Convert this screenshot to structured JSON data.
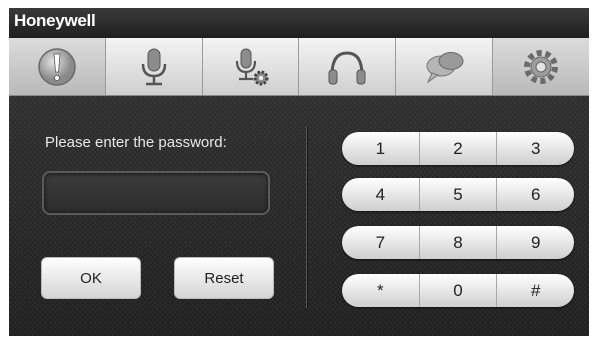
{
  "brand": "Honeywell",
  "toolbar": {
    "tabs": [
      {
        "icon": "alert-icon",
        "active": true
      },
      {
        "icon": "microphone-icon",
        "active": false
      },
      {
        "icon": "microphone-settings-icon",
        "active": false
      },
      {
        "icon": "headphones-icon",
        "active": false
      },
      {
        "icon": "speech-bubbles-icon",
        "active": false
      },
      {
        "icon": "gear-icon",
        "active": true
      }
    ]
  },
  "password": {
    "prompt": "Please enter the password:",
    "value": ""
  },
  "buttons": {
    "ok": "OK",
    "reset": "Reset"
  },
  "keypad": {
    "rows": [
      [
        "1",
        "2",
        "3"
      ],
      [
        "4",
        "5",
        "6"
      ],
      [
        "7",
        "8",
        "9"
      ],
      [
        "*",
        "0",
        "#"
      ]
    ]
  }
}
